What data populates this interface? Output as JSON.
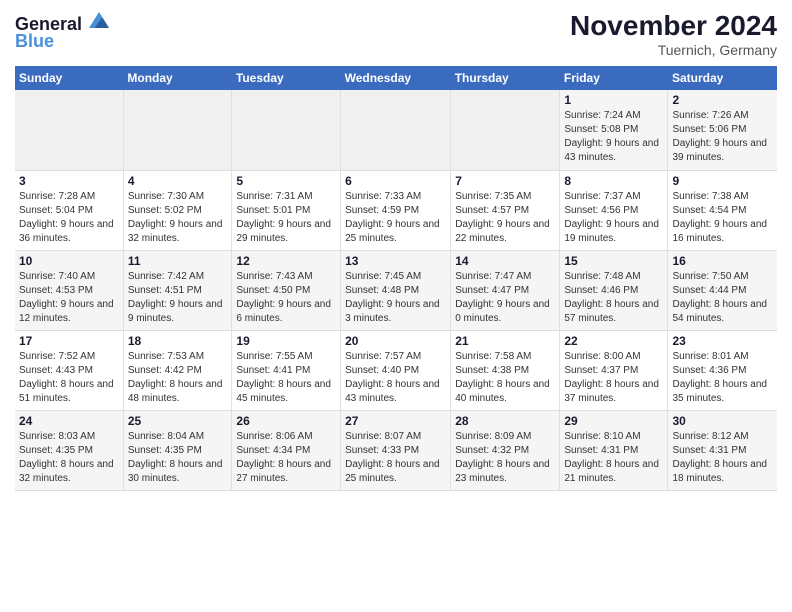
{
  "header": {
    "logo_line1": "General",
    "logo_line2": "Blue",
    "month_title": "November 2024",
    "subtitle": "Tuernich, Germany"
  },
  "days_of_week": [
    "Sunday",
    "Monday",
    "Tuesday",
    "Wednesday",
    "Thursday",
    "Friday",
    "Saturday"
  ],
  "weeks": [
    [
      {
        "day": "",
        "info": ""
      },
      {
        "day": "",
        "info": ""
      },
      {
        "day": "",
        "info": ""
      },
      {
        "day": "",
        "info": ""
      },
      {
        "day": "",
        "info": ""
      },
      {
        "day": "1",
        "info": "Sunrise: 7:24 AM\nSunset: 5:08 PM\nDaylight: 9 hours and 43 minutes."
      },
      {
        "day": "2",
        "info": "Sunrise: 7:26 AM\nSunset: 5:06 PM\nDaylight: 9 hours and 39 minutes."
      }
    ],
    [
      {
        "day": "3",
        "info": "Sunrise: 7:28 AM\nSunset: 5:04 PM\nDaylight: 9 hours and 36 minutes."
      },
      {
        "day": "4",
        "info": "Sunrise: 7:30 AM\nSunset: 5:02 PM\nDaylight: 9 hours and 32 minutes."
      },
      {
        "day": "5",
        "info": "Sunrise: 7:31 AM\nSunset: 5:01 PM\nDaylight: 9 hours and 29 minutes."
      },
      {
        "day": "6",
        "info": "Sunrise: 7:33 AM\nSunset: 4:59 PM\nDaylight: 9 hours and 25 minutes."
      },
      {
        "day": "7",
        "info": "Sunrise: 7:35 AM\nSunset: 4:57 PM\nDaylight: 9 hours and 22 minutes."
      },
      {
        "day": "8",
        "info": "Sunrise: 7:37 AM\nSunset: 4:56 PM\nDaylight: 9 hours and 19 minutes."
      },
      {
        "day": "9",
        "info": "Sunrise: 7:38 AM\nSunset: 4:54 PM\nDaylight: 9 hours and 16 minutes."
      }
    ],
    [
      {
        "day": "10",
        "info": "Sunrise: 7:40 AM\nSunset: 4:53 PM\nDaylight: 9 hours and 12 minutes."
      },
      {
        "day": "11",
        "info": "Sunrise: 7:42 AM\nSunset: 4:51 PM\nDaylight: 9 hours and 9 minutes."
      },
      {
        "day": "12",
        "info": "Sunrise: 7:43 AM\nSunset: 4:50 PM\nDaylight: 9 hours and 6 minutes."
      },
      {
        "day": "13",
        "info": "Sunrise: 7:45 AM\nSunset: 4:48 PM\nDaylight: 9 hours and 3 minutes."
      },
      {
        "day": "14",
        "info": "Sunrise: 7:47 AM\nSunset: 4:47 PM\nDaylight: 9 hours and 0 minutes."
      },
      {
        "day": "15",
        "info": "Sunrise: 7:48 AM\nSunset: 4:46 PM\nDaylight: 8 hours and 57 minutes."
      },
      {
        "day": "16",
        "info": "Sunrise: 7:50 AM\nSunset: 4:44 PM\nDaylight: 8 hours and 54 minutes."
      }
    ],
    [
      {
        "day": "17",
        "info": "Sunrise: 7:52 AM\nSunset: 4:43 PM\nDaylight: 8 hours and 51 minutes."
      },
      {
        "day": "18",
        "info": "Sunrise: 7:53 AM\nSunset: 4:42 PM\nDaylight: 8 hours and 48 minutes."
      },
      {
        "day": "19",
        "info": "Sunrise: 7:55 AM\nSunset: 4:41 PM\nDaylight: 8 hours and 45 minutes."
      },
      {
        "day": "20",
        "info": "Sunrise: 7:57 AM\nSunset: 4:40 PM\nDaylight: 8 hours and 43 minutes."
      },
      {
        "day": "21",
        "info": "Sunrise: 7:58 AM\nSunset: 4:38 PM\nDaylight: 8 hours and 40 minutes."
      },
      {
        "day": "22",
        "info": "Sunrise: 8:00 AM\nSunset: 4:37 PM\nDaylight: 8 hours and 37 minutes."
      },
      {
        "day": "23",
        "info": "Sunrise: 8:01 AM\nSunset: 4:36 PM\nDaylight: 8 hours and 35 minutes."
      }
    ],
    [
      {
        "day": "24",
        "info": "Sunrise: 8:03 AM\nSunset: 4:35 PM\nDaylight: 8 hours and 32 minutes."
      },
      {
        "day": "25",
        "info": "Sunrise: 8:04 AM\nSunset: 4:35 PM\nDaylight: 8 hours and 30 minutes."
      },
      {
        "day": "26",
        "info": "Sunrise: 8:06 AM\nSunset: 4:34 PM\nDaylight: 8 hours and 27 minutes."
      },
      {
        "day": "27",
        "info": "Sunrise: 8:07 AM\nSunset: 4:33 PM\nDaylight: 8 hours and 25 minutes."
      },
      {
        "day": "28",
        "info": "Sunrise: 8:09 AM\nSunset: 4:32 PM\nDaylight: 8 hours and 23 minutes."
      },
      {
        "day": "29",
        "info": "Sunrise: 8:10 AM\nSunset: 4:31 PM\nDaylight: 8 hours and 21 minutes."
      },
      {
        "day": "30",
        "info": "Sunrise: 8:12 AM\nSunset: 4:31 PM\nDaylight: 8 hours and 18 minutes."
      }
    ]
  ]
}
